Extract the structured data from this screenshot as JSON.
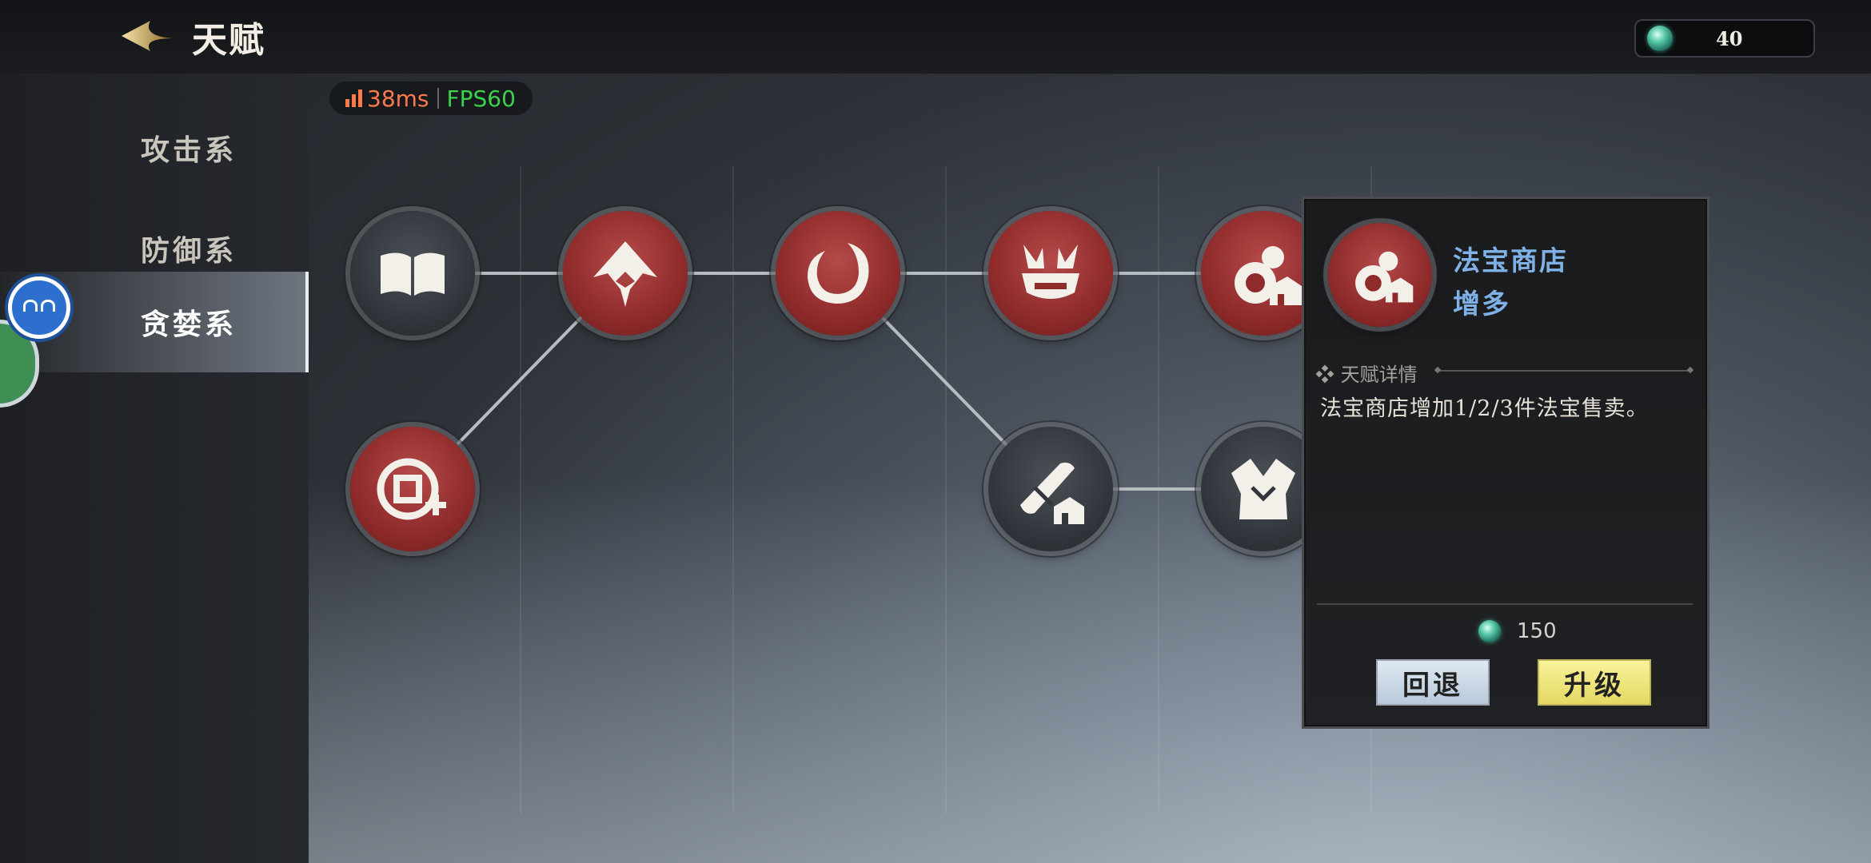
{
  "header": {
    "title": "天赋",
    "currency_amount": "40"
  },
  "sidebar": {
    "items": [
      {
        "label": "攻击系",
        "active": false
      },
      {
        "label": "防御系",
        "active": false
      },
      {
        "label": "贪婪系",
        "active": true
      }
    ]
  },
  "perf": {
    "ping": "38ms",
    "fps": "FPS60"
  },
  "talents": [
    {
      "id": "book",
      "state": "locked",
      "icon": "book-icon"
    },
    {
      "id": "crown",
      "state": "learned",
      "icon": "crown-icon"
    },
    {
      "id": "ring",
      "state": "learned",
      "icon": "ring-icon"
    },
    {
      "id": "claws",
      "state": "learned",
      "icon": "claws-icon"
    },
    {
      "id": "gourd",
      "state": "learned",
      "icon": "gourd-shop-icon"
    },
    {
      "id": "coin-plus",
      "state": "learned",
      "icon": "coin-plus-icon"
    },
    {
      "id": "scroll",
      "state": "locked",
      "icon": "scroll-shop-icon"
    },
    {
      "id": "armor",
      "state": "locked",
      "icon": "armor-shop-icon"
    }
  ],
  "detail": {
    "title_line1": "法宝商店",
    "title_line2": "增多",
    "section_label": "天赋详情",
    "description": "法宝商店增加1/2/3件法宝售卖。",
    "cost": "150",
    "back_label": "回退",
    "upgrade_label": "升级"
  },
  "colors": {
    "learned": "#8f2b2b",
    "locked": "#33373d",
    "title_blue": "#7fb0e6",
    "upgrade": "#f2ea86",
    "back": "#cddbe9"
  }
}
